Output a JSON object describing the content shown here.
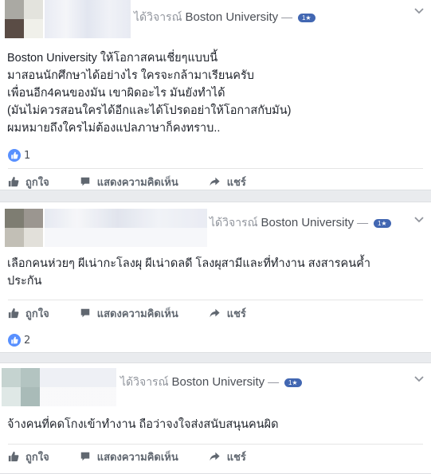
{
  "posts": [
    {
      "headline_prefix": "ได้วิจารณ์",
      "page_name": "Boston University",
      "separator": "—",
      "rating": "1★",
      "text_lines": [
        "Boston University ให้โอกาสคนเชี่ยๆแบบนี้",
        "มาสอนนักศึกษาได้อย่างไร ใครจะกล้ามาเรียนครับ",
        "เพื่อนอีก4คนของมัน เขาผิดอะไร มันยังทำได้",
        "(มันไม่ควรสอนใครได้อีกและได้โปรดอย่าให้โอกาสกับมัน)",
        "ผมหมายถึงใครไม่ต้องแปลภาษาก็คงทราบ.."
      ],
      "like_count": "1",
      "actions": {
        "like": "ถูกใจ",
        "comment": "แสดงความคิดเห็น",
        "share": "แชร์"
      }
    },
    {
      "headline_prefix": "ได้วิจารณ์",
      "page_name": "Boston University",
      "separator": "—",
      "rating": "1★",
      "text_lines": [
        "เลือกคนห่วยๆ ผีเน่ากะโลงผุ ผีเน่าดลดี โลงผุสามีและที่ทำงาน สงสารคนค้ำ",
        "ประกัน"
      ],
      "like_count": "2",
      "actions": {
        "like": "ถูกใจ",
        "comment": "แสดงความคิดเห็น",
        "share": "แชร์"
      }
    },
    {
      "headline_prefix": "ได้วิจารณ์",
      "page_name": "Boston University",
      "separator": "—",
      "rating": "1★",
      "text_lines": [
        "จ้างคนที่คดโกงเข้าทำงาน ถือว่าจงใจส่งสนับสนุนคนผิด"
      ],
      "actions": {
        "like": "ถูกใจ",
        "comment": "แสดงความคิดเห็น",
        "share": "แชร์"
      }
    }
  ],
  "colors": {
    "background": "#e9ebee",
    "card": "#ffffff",
    "accent": "#4267b2",
    "like_blue": "#5890ff",
    "meta_text": "#90949c",
    "action_text": "#606770"
  },
  "icons": [
    "chevron-down-icon",
    "like-reaction-icon",
    "thumbs-up-icon",
    "comment-icon",
    "share-arrow-icon"
  ]
}
